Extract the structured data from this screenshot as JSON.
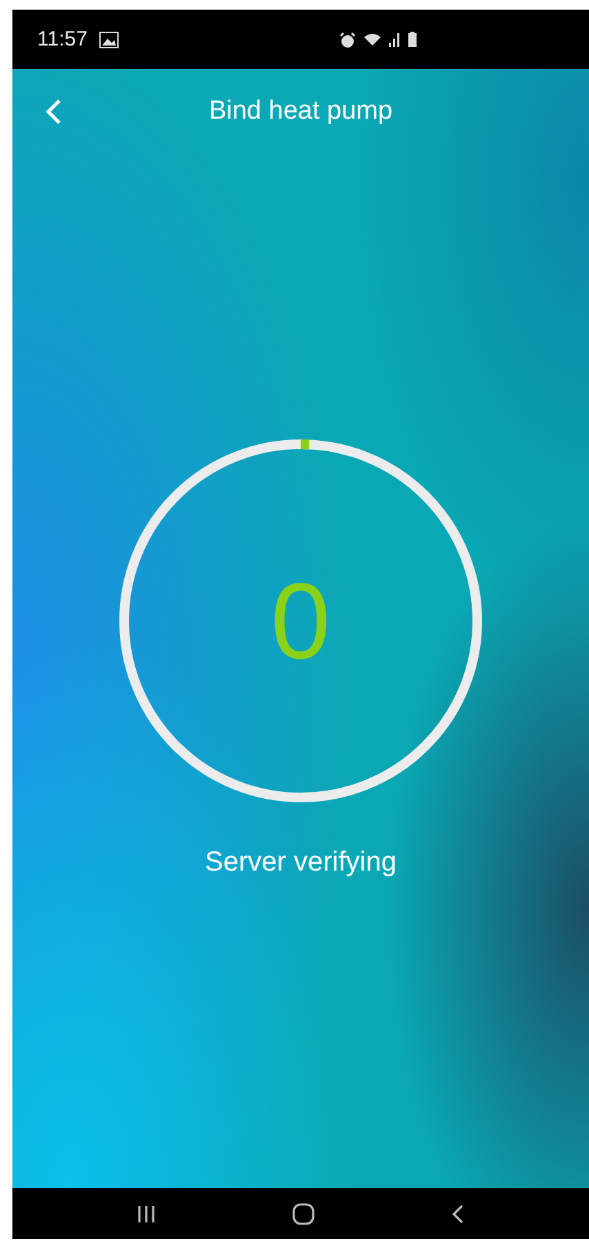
{
  "status_bar": {
    "time": "11:57"
  },
  "header": {
    "title": "Bind heat pump"
  },
  "progress": {
    "level": 0.015,
    "count": "0",
    "message": "Server verifying"
  }
}
